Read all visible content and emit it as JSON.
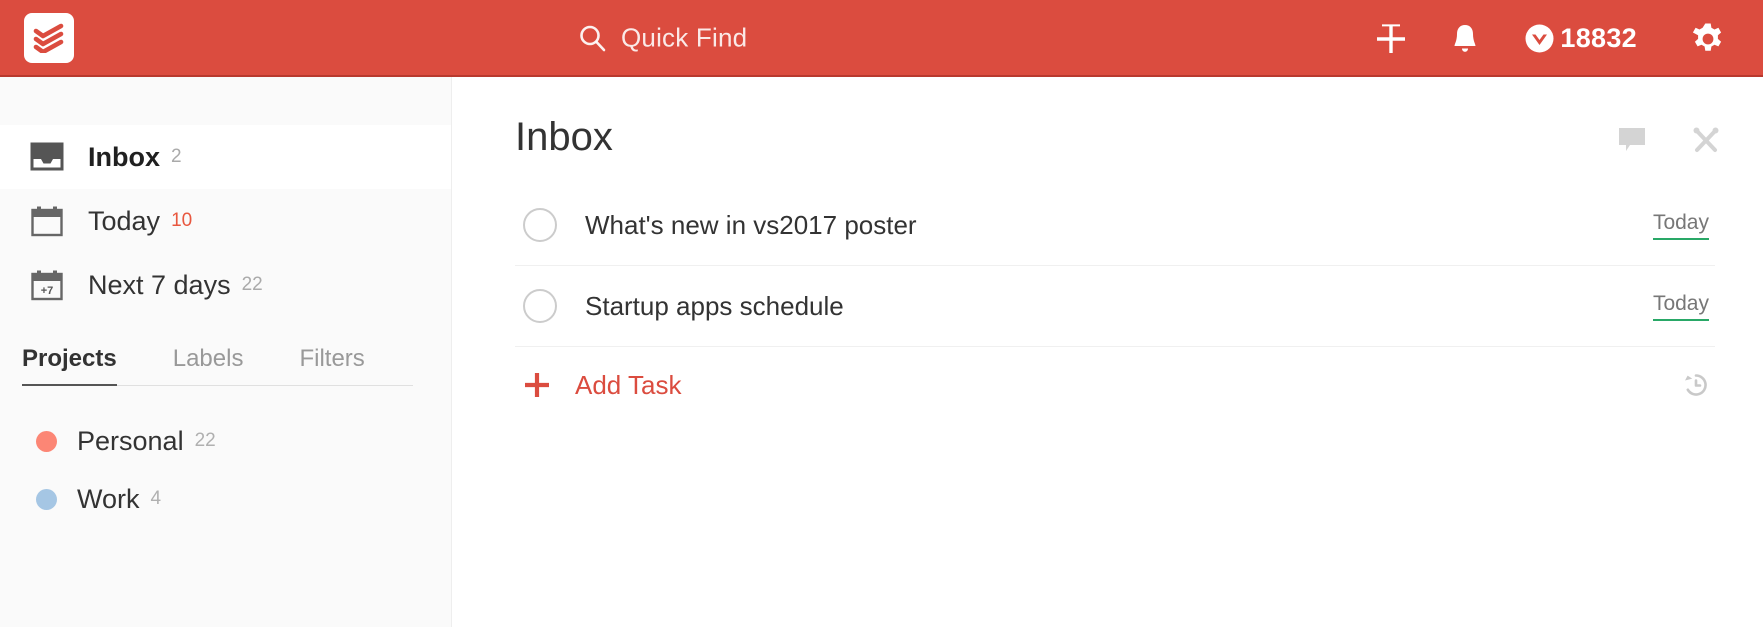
{
  "topbar": {
    "logo_icon": "todoist-logo-icon",
    "quick_find": {
      "icon": "search-icon",
      "label": "Quick Find"
    },
    "add_icon": "plus-icon",
    "notifications_icon": "bell-icon",
    "karma": {
      "icon": "karma-chevron-icon",
      "count": "18832"
    },
    "settings_icon": "gear-icon",
    "background_color": "#db4c3f"
  },
  "sidebar": {
    "nav": [
      {
        "icon": "inbox-icon",
        "label": "Inbox",
        "count": "2",
        "active": true,
        "count_accent": false
      },
      {
        "icon": "today-calendar-icon",
        "label": "Today",
        "count": "10",
        "active": false,
        "count_accent": true
      },
      {
        "icon": "next7days-calendar-icon",
        "label": "Next 7 days",
        "count": "22",
        "active": false,
        "count_accent": false
      }
    ],
    "tabs": [
      {
        "label": "Projects",
        "active": true
      },
      {
        "label": "Labels",
        "active": false
      },
      {
        "label": "Filters",
        "active": false
      }
    ],
    "projects": [
      {
        "label": "Personal",
        "count": "22",
        "color": "#fc8675"
      },
      {
        "label": "Work",
        "count": "4",
        "color": "#a5c6e4"
      }
    ]
  },
  "main": {
    "title": "Inbox",
    "actions": [
      {
        "icon": "comment-icon"
      },
      {
        "icon": "tools-icon"
      }
    ],
    "tasks": [
      {
        "text": "What's new in vs2017 poster",
        "due": "Today",
        "checkbox": "task-checkbox"
      },
      {
        "text": "Startup apps schedule",
        "due": "Today",
        "checkbox": "task-checkbox"
      }
    ],
    "add_task": {
      "icon": "plus-icon",
      "label": "Add Task"
    },
    "history_icon": "history-icon",
    "accent_color": "#db4c3f",
    "due_underline_color": "#29a867"
  }
}
